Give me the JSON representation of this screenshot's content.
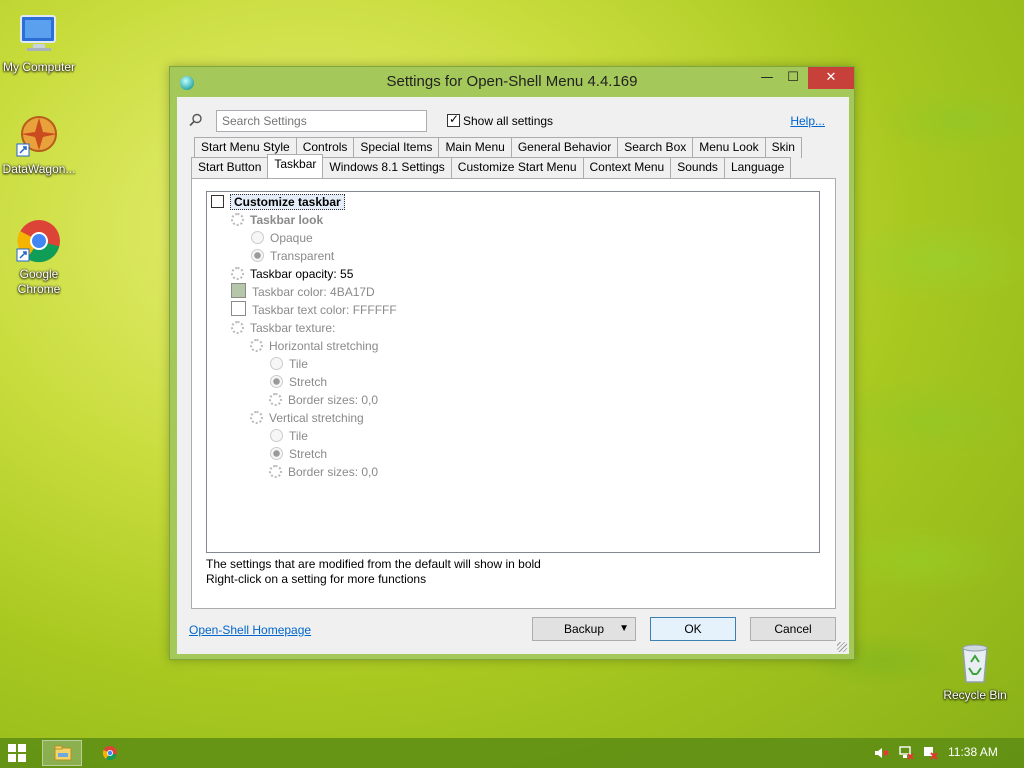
{
  "desktop": {
    "icons": [
      {
        "label": "My Computer",
        "icon": "monitor-icon"
      },
      {
        "label": "DataWagon...",
        "icon": "datawagon-icon"
      },
      {
        "label": "Google Chrome",
        "icon": "chrome-icon"
      },
      {
        "label": "Recycle Bin",
        "icon": "recycle-bin-icon"
      }
    ]
  },
  "window": {
    "title": "Settings for Open-Shell Menu 4.4.169",
    "min_glyph": "—",
    "max_glyph": "☐",
    "close_glyph": "✕"
  },
  "search": {
    "placeholder": "Search Settings",
    "show_all_label": "Show all settings",
    "show_all_checked": true,
    "help_label": "Help..."
  },
  "tabs": {
    "row1": [
      "Start Menu Style",
      "Controls",
      "Special Items",
      "Main Menu",
      "General Behavior",
      "Search Box",
      "Menu Look",
      "Skin"
    ],
    "row2": [
      "Start Button",
      "Taskbar",
      "Windows 8.1 Settings",
      "Customize Start Menu",
      "Context Menu",
      "Sounds",
      "Language"
    ],
    "active": "Taskbar"
  },
  "tree": {
    "customize_taskbar": "Customize taskbar",
    "taskbar_look": "Taskbar look",
    "opaque": "Opaque",
    "transparent": "Transparent",
    "taskbar_opacity": "Taskbar opacity: 55",
    "taskbar_color": "Taskbar color: 4BA17D",
    "taskbar_text_color": "Taskbar text color: FFFFFF",
    "taskbar_texture": "Taskbar texture:",
    "horizontal_stretching": "Horizontal stretching",
    "h_tile": "Tile",
    "h_stretch": "Stretch",
    "h_border": "Border sizes: 0,0",
    "vertical_stretching": "Vertical stretching",
    "v_tile": "Tile",
    "v_stretch": "Stretch",
    "v_border": "Border sizes: 0,0",
    "swatch_color": "#b6c6a8",
    "text_swatch_color": "#ffffff"
  },
  "info": {
    "line1": "The settings that are modified from the default will show in bold",
    "line2": "Right-click on a setting for more functions"
  },
  "footer": {
    "homepage_link": "Open-Shell Homepage",
    "backup_label": "Backup",
    "ok_label": "OK",
    "cancel_label": "Cancel"
  },
  "taskbar": {
    "clock": "11:38 AM",
    "tray_icons": [
      "speaker-muted-icon",
      "network-icon",
      "action-center-icon"
    ]
  }
}
